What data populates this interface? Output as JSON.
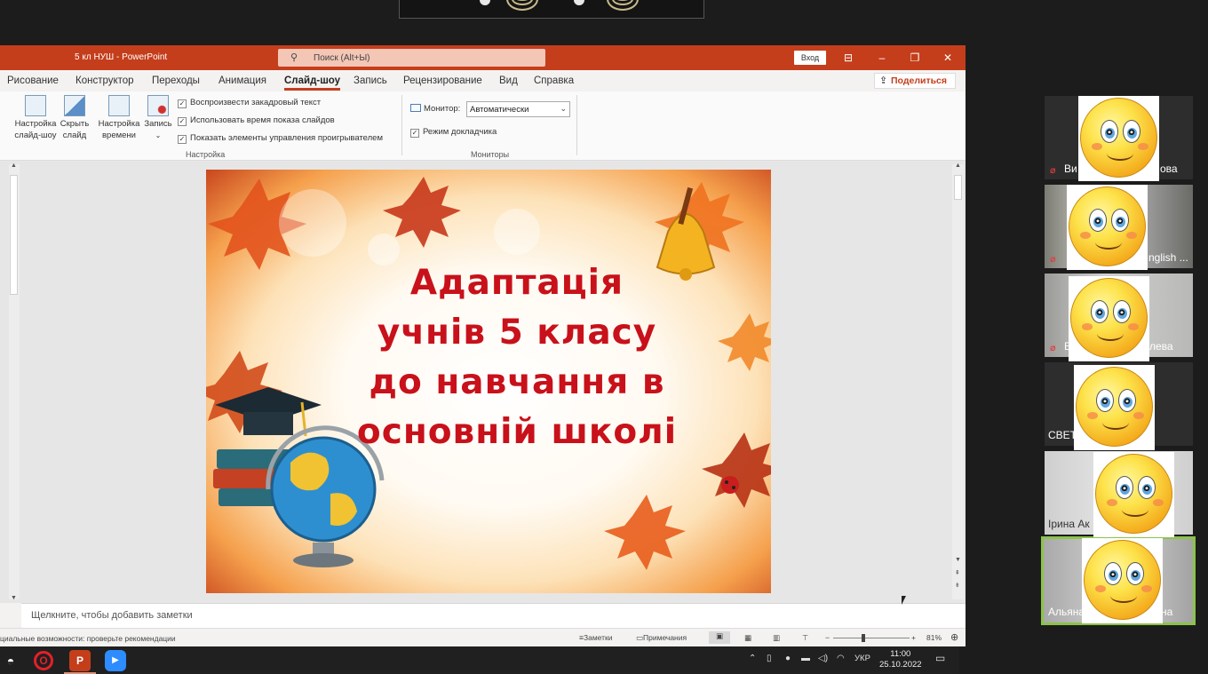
{
  "window": {
    "title": "5 кл НУШ  -  PowerPoint",
    "search_placeholder": "Поиск (Alt+Ы)",
    "signin_label": "Вход",
    "share_label": "Поделиться"
  },
  "tabs": [
    "Рисование",
    "Конструктор",
    "Переходы",
    "Анимация",
    "Слайд-шоу",
    "Запись",
    "Рецензирование",
    "Вид",
    "Справка"
  ],
  "active_tab": "Слайд-шоу",
  "ribbon": {
    "buttons": [
      {
        "label": "Настройка слайд-шоу"
      },
      {
        "label": "Скрыть слайд"
      },
      {
        "label": "Настройка времени"
      },
      {
        "label": "Запись"
      }
    ],
    "checkboxes": [
      {
        "label": "Воспроизвести закадровый текст",
        "checked": true
      },
      {
        "label": "Использовать время показа слайдов",
        "checked": true
      },
      {
        "label": "Показать элементы управления проигрывателем",
        "checked": true
      }
    ],
    "group_setup_label": "Настройка",
    "monitor_label": "Монитор:",
    "monitor_value": "Автоматически",
    "presenter_view_label": "Режим докладчика",
    "presenter_view_checked": true,
    "group_monitors_label": "Мониторы"
  },
  "slide": {
    "title_lines": [
      "Адаптація",
      "учнів 5 класу",
      "до навчання в",
      "основній школі"
    ]
  },
  "notes_placeholder": "Щелкните, чтобы добавить заметки",
  "status": {
    "accessibility": "циальные возможности: проверьте рекомендации",
    "notes_label": "Заметки",
    "comments_label": "Примечания",
    "zoom": "81%"
  },
  "taskbar": {
    "language": "УКР",
    "time": "11:00",
    "date": "25.10.2022"
  },
  "participants": [
    {
      "name_left": "Ви",
      "name_right": "ова",
      "muted": true
    },
    {
      "name_left": "",
      "name_right": "nglish ...",
      "muted": true
    },
    {
      "name_left": "Е",
      "name_right": "лева",
      "muted": true
    },
    {
      "name_left": "СВЕТ",
      "name_right": "",
      "muted": false
    },
    {
      "name_left": "Ірина Ак",
      "name_right": "",
      "muted": false
    },
    {
      "name_left": "Альяна",
      "name_right": "на",
      "muted": false,
      "active_speaker": true
    }
  ],
  "colors": {
    "ppt_accent": "#c43e1c",
    "slide_title": "#c8111a",
    "active_speaker_border": "#8bc34a"
  }
}
